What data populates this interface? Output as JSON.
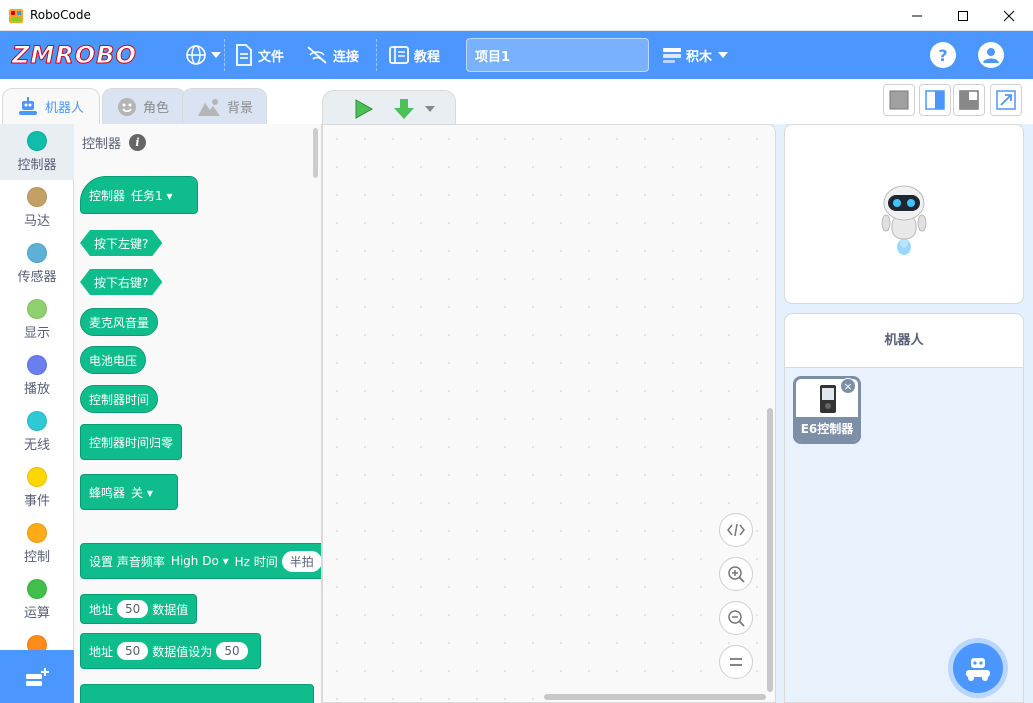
{
  "window": {
    "title": "RoboCode",
    "minimize_icon": "minimize-icon",
    "maximize_icon": "maximize-icon",
    "close_icon": "close-icon"
  },
  "topnav": {
    "logo": "ZMROBO",
    "language_icon": "globe-icon",
    "file_label": "文件",
    "connect_label": "连接",
    "tutorial_label": "教程",
    "project_name": "项目1",
    "mode_label": "积木",
    "help_label": "?",
    "accent": "#4c97ff"
  },
  "tabs": [
    {
      "label": "机器人",
      "icon": "robot-icon",
      "active": true
    },
    {
      "label": "角色",
      "icon": "smiley-icon",
      "active": false
    },
    {
      "label": "背景",
      "icon": "landscape-icon",
      "active": false
    }
  ],
  "categories": [
    {
      "label": "控制器",
      "color": "#0fbdaa"
    },
    {
      "label": "马达",
      "color": "#c4a064"
    },
    {
      "label": "传感器",
      "color": "#5cb1d6"
    },
    {
      "label": "显示",
      "color": "#8fd16e"
    },
    {
      "label": "播放",
      "color": "#6b7ef0"
    },
    {
      "label": "无线",
      "color": "#2fc9d6"
    },
    {
      "label": "事件",
      "color": "#ffd500"
    },
    {
      "label": "控制",
      "color": "#ffab19"
    },
    {
      "label": "运算",
      "color": "#40bf4a"
    },
    {
      "label": "",
      "color": "#ff8c1a"
    }
  ],
  "palette": {
    "title": "控制器",
    "blocks": {
      "controller_task": {
        "label": "控制器",
        "value": "任务1"
      },
      "press_left": "按下左键?",
      "press_right": "按下右键?",
      "mic_volume": "麦克风音量",
      "battery_voltage": "电池电压",
      "controller_time": "控制器时间",
      "controller_time_reset": "控制器时间归零",
      "buzzer": {
        "label": "蜂鸣器",
        "value": "关"
      },
      "set_tone": {
        "label": "设置 声音频率",
        "value": "High Do",
        "unit": "Hz 时间",
        "time": "半拍"
      },
      "address_data": {
        "label1": "地址",
        "value": "50",
        "label2": "数据值"
      },
      "address_set": {
        "label1": "地址",
        "value": "50",
        "label2": "数据值设为",
        "value2": "50"
      }
    }
  },
  "workspace": {
    "zoom_buttons": [
      "code-icon",
      "zoom-in-icon",
      "zoom-out-icon",
      "zoom-reset-icon"
    ]
  },
  "sprite_panel": {
    "title": "机器人",
    "sprite_label": "E6控制器"
  }
}
